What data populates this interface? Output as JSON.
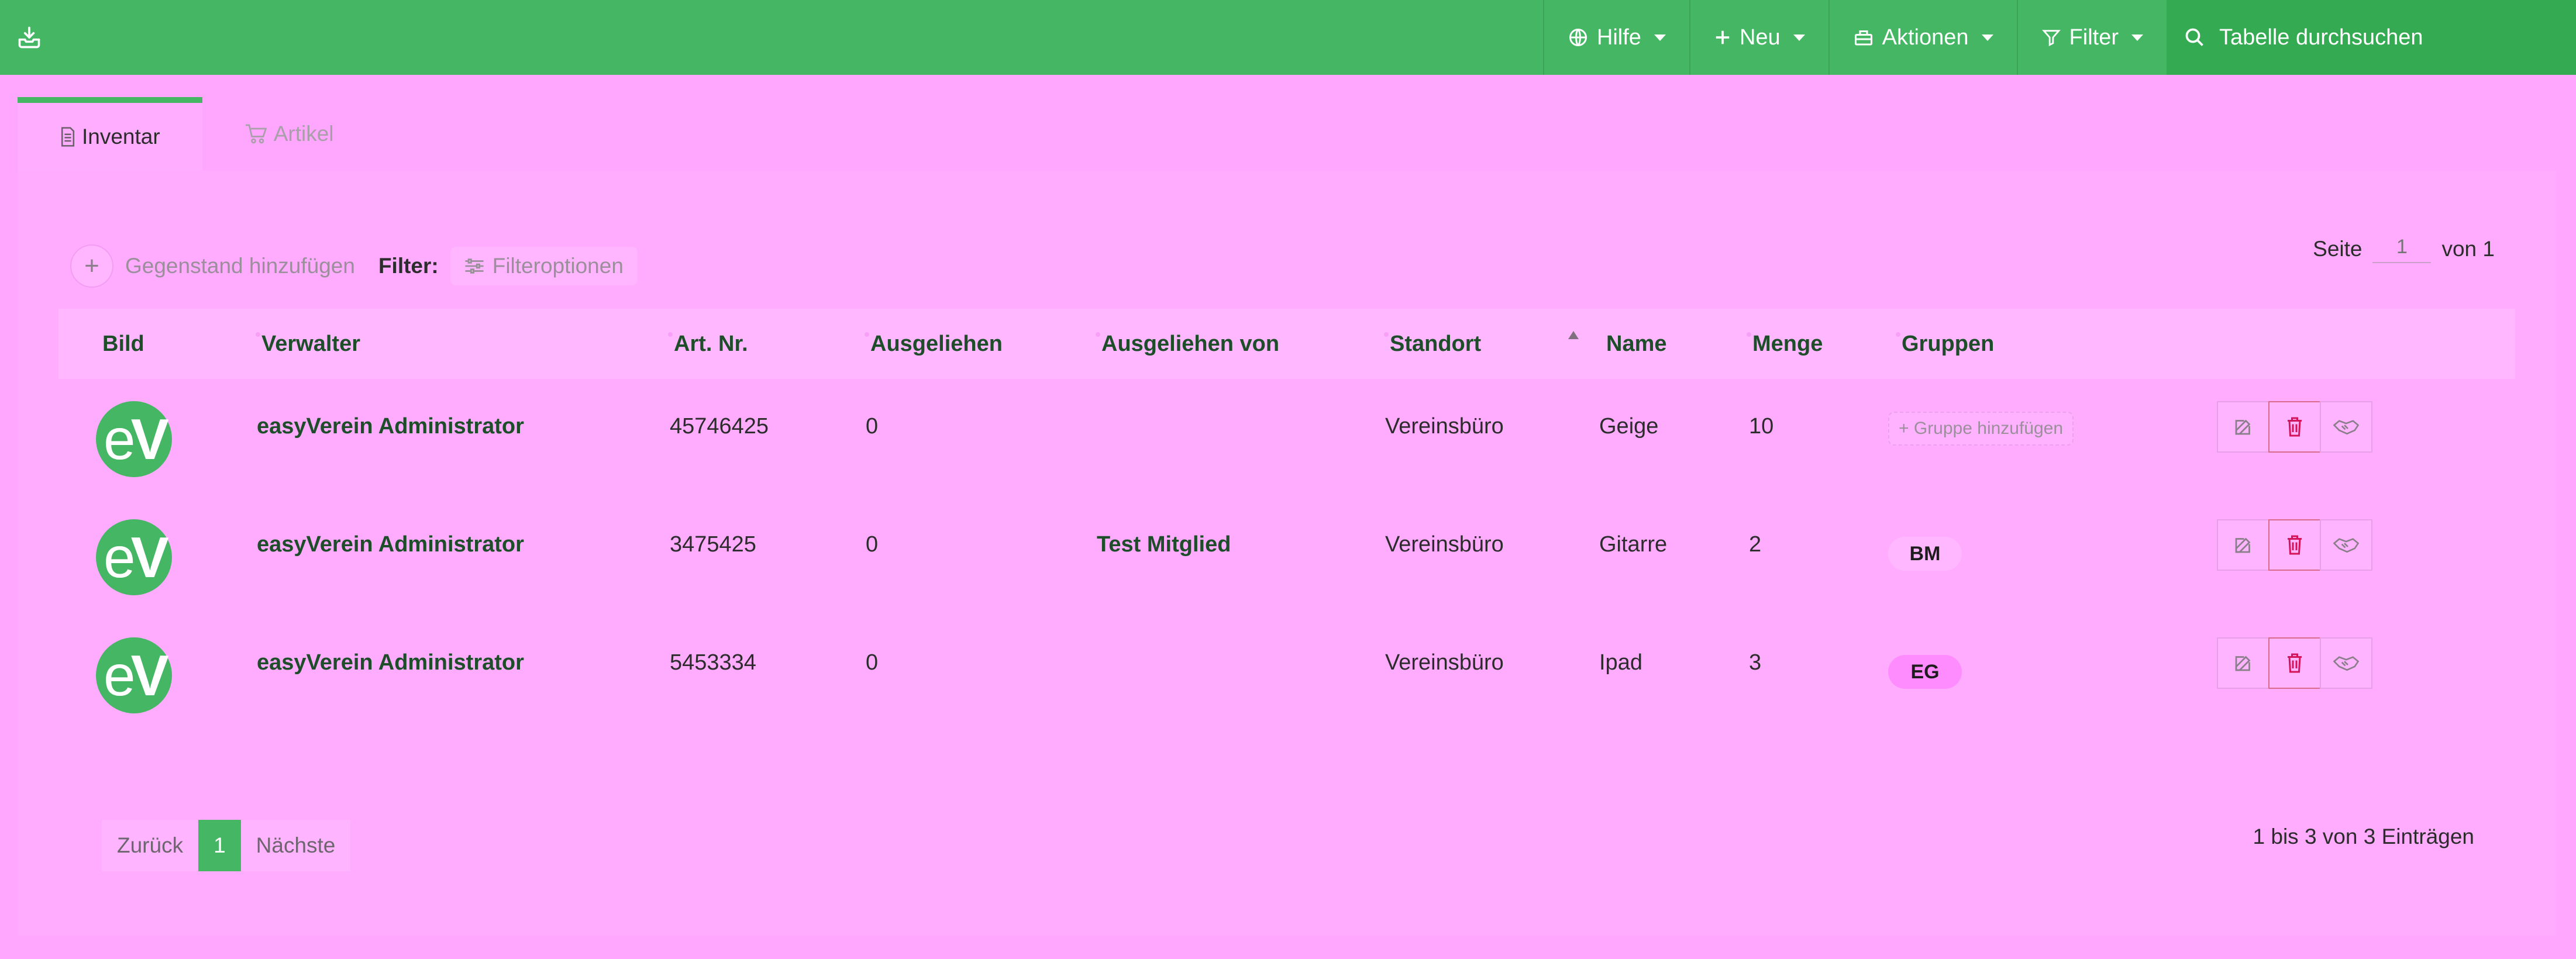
{
  "colors": {
    "brand_green": "#45b664",
    "search_green": "#34ab52",
    "page_bg": "#ffa6ff",
    "delete_red": "#d4145a"
  },
  "topbar": {
    "logo_icon": "download-tray-icon",
    "help_label": "Hilfe",
    "new_label": "Neu",
    "actions_label": "Aktionen",
    "filter_label": "Filter",
    "search_placeholder": "Tabelle durchsuchen"
  },
  "tabs": [
    {
      "label": "Inventar",
      "icon": "document-icon",
      "active": true
    },
    {
      "label": "Artikel",
      "icon": "cart-icon",
      "active": false
    }
  ],
  "toolbar": {
    "add_label": "Gegenstand hinzufügen",
    "filter_label": "Filter:",
    "filter_options_label": "Filteroptionen"
  },
  "pager_top": {
    "page_label": "Seite",
    "page_value": "1",
    "of_label": "von 1"
  },
  "table": {
    "columns": [
      "Bild",
      "Verwalter",
      "Art. Nr.",
      "Ausgeliehen",
      "Ausgeliehen von",
      "Standort",
      "Name",
      "Menge",
      "Gruppen"
    ],
    "sorted_column": "Name",
    "rows": [
      {
        "avatar": "eV",
        "manager": "easyVerein Administrator",
        "art_nr": "45746425",
        "lent": "0",
        "lent_by": "",
        "location": "Vereinsbüro",
        "name": "Geige",
        "qty": "10",
        "group": "",
        "group_add": "+ Gruppe hinzufügen",
        "group_color": ""
      },
      {
        "avatar": "eV",
        "manager": "easyVerein Administrator",
        "art_nr": "3475425",
        "lent": "0",
        "lent_by": "Test Mitglied",
        "location": "Vereinsbüro",
        "name": "Gitarre",
        "qty": "2",
        "group": "BM",
        "group_add": "",
        "group_color": "#ffb8ff"
      },
      {
        "avatar": "eV",
        "manager": "easyVerein Administrator",
        "art_nr": "5453334",
        "lent": "0",
        "lent_by": "",
        "location": "Vereinsbüro",
        "name": "Ipad",
        "qty": "3",
        "group": "EG",
        "group_add": "",
        "group_color": "#ff8cff"
      }
    ]
  },
  "pager_bottom": {
    "prev_label": "Zurück",
    "current_page": "1",
    "next_label": "Nächste",
    "entries_text": "1 bis 3 von 3 Einträgen"
  }
}
